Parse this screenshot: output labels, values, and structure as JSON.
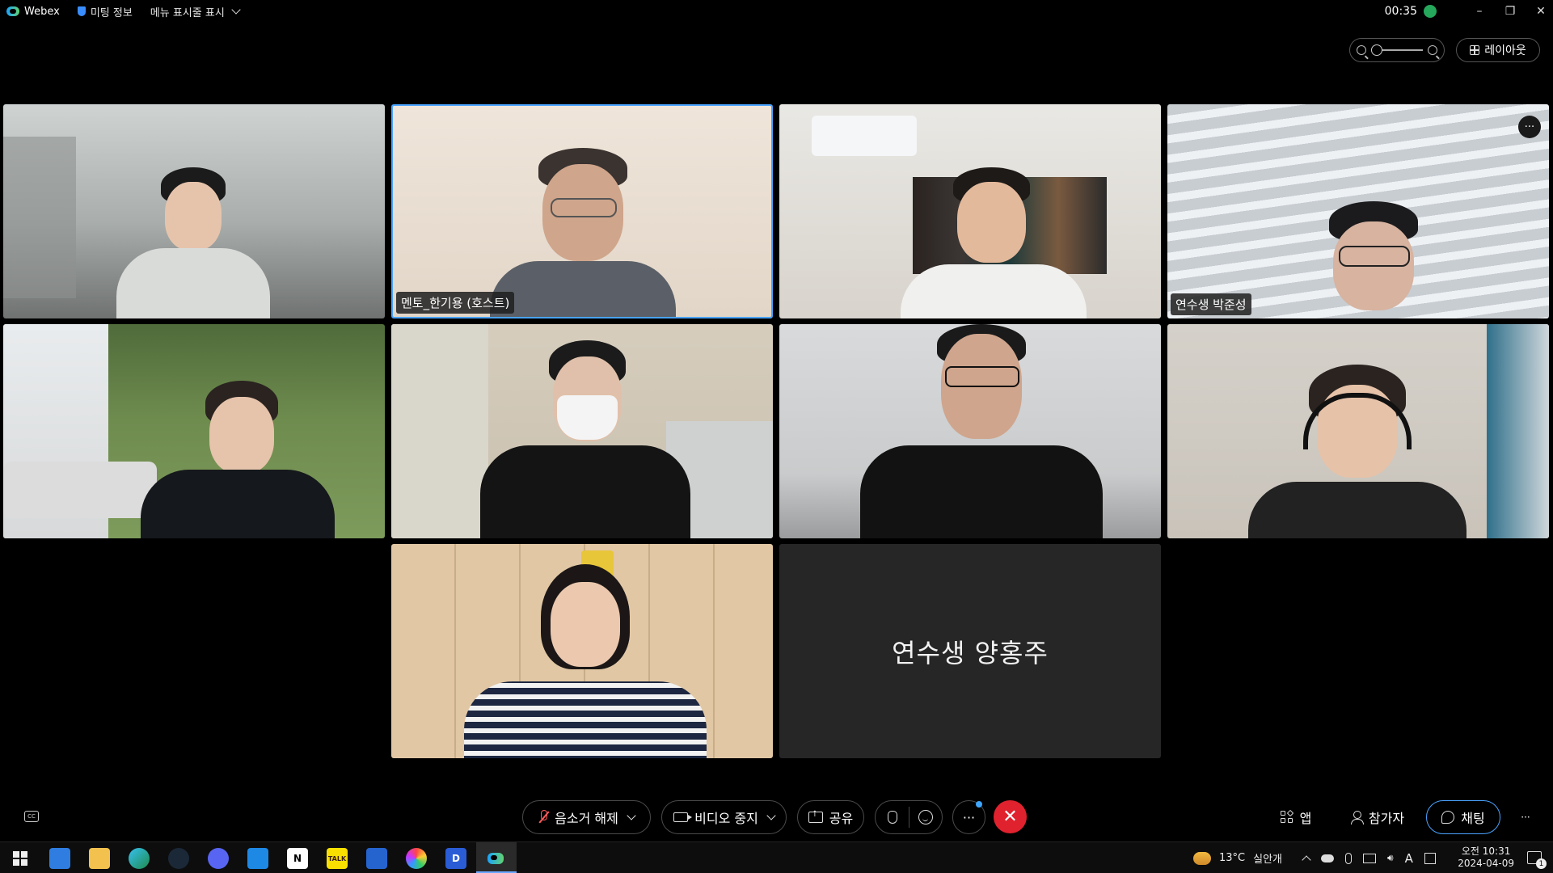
{
  "titlebar": {
    "app_name": "Webex",
    "meeting_info": "미팅 정보",
    "show_menu": "메뉴 표시줄 표시",
    "elapsed": "00:35",
    "minimize": "–",
    "restore": "❐",
    "close": "✕"
  },
  "top_controls": {
    "layout_label": "레이아웃"
  },
  "tiles": [
    {
      "name": ""
    },
    {
      "name": "멘토_한기용 (호스트)"
    },
    {
      "name": ""
    },
    {
      "name": "연수생 박준성",
      "more": "···"
    },
    {
      "name": ""
    },
    {
      "name": ""
    },
    {
      "name": ""
    },
    {
      "name": ""
    },
    {
      "name": ""
    },
    {
      "name": "연수생 양홍주"
    }
  ],
  "toolbar": {
    "cc": "CC",
    "unmute": "음소거 해제",
    "stop_video": "비디오 중지",
    "share": "공유",
    "more": "···",
    "end": "✕",
    "apps": "앱",
    "participants": "참가자",
    "chat": "채팅",
    "overflow": "···"
  },
  "taskbar": {
    "weather_temp": "13°C",
    "weather_desc": "실안개",
    "ime": "A",
    "clock_time": "오전 10:31",
    "clock_date": "2024-04-09",
    "notification_count": "1"
  },
  "colors": {
    "accent_blue": "#4aa3ff",
    "end_red": "#e0222e",
    "tile_dark": "#262626"
  }
}
